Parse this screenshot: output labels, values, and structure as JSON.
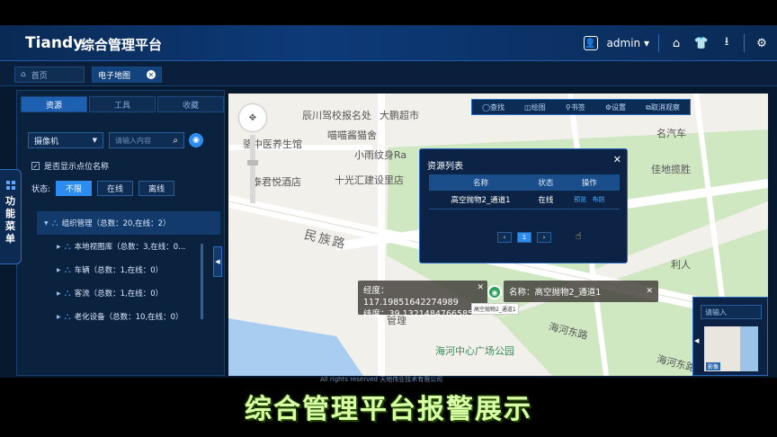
{
  "header": {
    "logo": "Tiandy",
    "title": "综合管理平台",
    "user": "admin",
    "user_caret": "▾",
    "icons": [
      "user-icon",
      "home-icon",
      "shirt-icon",
      "download-icon",
      "gear-icon"
    ]
  },
  "tabs": [
    {
      "label": "首页",
      "icon": "home-icon"
    },
    {
      "label": "电子地图",
      "close": "✕"
    }
  ],
  "side_menu": {
    "label": "功能菜单"
  },
  "panel": {
    "tabs": [
      "资源",
      "工具",
      "收藏"
    ],
    "device_select": "摄像机",
    "search_placeholder": "请输入内容",
    "show_name_label": "是否显示点位名称",
    "status_label": "状态:",
    "status_options": [
      "不限",
      "在线",
      "离线"
    ],
    "tree": {
      "root": "组织管理（总数：20,在线：2）",
      "children": [
        "本地视图库（总数：3,在线：0...",
        "车辆（总数：1,在线：0）",
        "客流（总数：1,在线：0）",
        "老化设备（总数：10,在线：0）"
      ]
    }
  },
  "map_toolbar": [
    "◯查找",
    "◫绘图",
    "⚲书签",
    "⚙设置",
    "⧉取消观察"
  ],
  "map_labels": {
    "l1": "辰川驾校报名处",
    "l2": "大鹏超市",
    "l3": "喵喵酱猫舍",
    "l4": "小雨纹身Ra",
    "l5": "骆中医养生馆",
    "l6": "泰君悦酒店",
    "l7": "十光汇建设里店",
    "l8": "民族路",
    "l9": "管理",
    "l10": "海河中心广场公园",
    "l11": "海河东路",
    "l12": "佳地揽胜",
    "l13": "名汽车",
    "l14": "海河东路",
    "l15": "利人"
  },
  "resource_popup": {
    "title": "资源列表",
    "close": "✕",
    "columns": [
      "名称",
      "状态",
      "操作"
    ],
    "rows": [
      {
        "name": "高空抛物2_通道1",
        "status": "在线",
        "ops": [
          "预览",
          "布防"
        ]
      }
    ],
    "pager": [
      "‹",
      "1",
      "›"
    ]
  },
  "coords": {
    "lng_label": "经度：117.19851642274989",
    "lat_label": "纬度：39.1321484766585",
    "close": "✕"
  },
  "marker": {
    "name": "名称：高空抛物2_通道1",
    "tag": "高空抛物2_通道1",
    "close": "✕"
  },
  "mini_map": {
    "placeholder": "请输入",
    "badge": "影像"
  },
  "copyright": "All rights reserved 天地伟业技术有限公司",
  "caption": "综合管理平台报警展示"
}
